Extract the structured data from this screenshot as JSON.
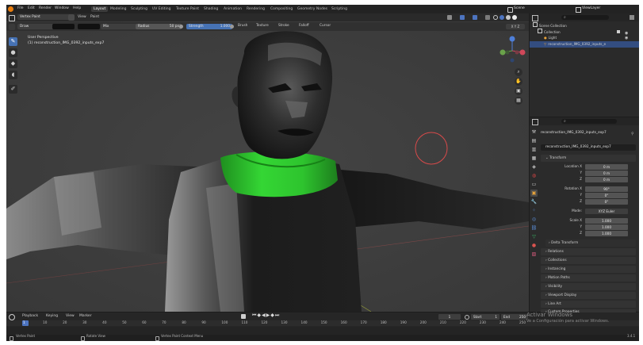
{
  "topbar": {
    "menus": [
      "File",
      "Edit",
      "Render",
      "Window",
      "Help"
    ],
    "workspaces": [
      "Layout",
      "Modeling",
      "Sculpting",
      "UV Editing",
      "Texture Paint",
      "Shading",
      "Animation",
      "Rendering",
      "Compositing",
      "Geometry Nodes",
      "Scripting"
    ],
    "active_workspace": "Layout",
    "scene": "Scene",
    "view_layer": "ViewLayer"
  },
  "viewport_header": {
    "mode": "Vertex Paint",
    "view_label": "View",
    "paint_label": "Paint"
  },
  "tool_settings": {
    "brush_name": "Draw",
    "blend": "Mix",
    "radius_label": "Radius",
    "radius_value": "50 px",
    "strength_label": "Strength",
    "strength_value": "1.000",
    "menus": [
      "Brush",
      "Texture",
      "Stroke",
      "Falloff",
      "Cursor"
    ]
  },
  "viewport": {
    "perspective": "User Perspective",
    "object_line": "(1) reconstruction_IMG_0392_inputs_exp7",
    "axes": [
      "X",
      "Y",
      "Z"
    ],
    "brush_color": "#2ecc2e"
  },
  "outliner": {
    "search_placeholder": "",
    "items": [
      {
        "label": "Scene Collection"
      },
      {
        "label": "Collection"
      },
      {
        "label": "Light"
      },
      {
        "label": "reconstruction_IMG_0392_inputs_e"
      }
    ]
  },
  "properties": {
    "object_name": "reconstruction_IMG_0392_inputs_exp7",
    "object_field": "reconstruction_IMG_0392_inputs_exp7",
    "transform_label": "Transform",
    "location": {
      "label": "Location X",
      "x": "0 m",
      "y": "0 m",
      "z": "0 m"
    },
    "rotation": {
      "label": "Rotation X",
      "x": "90°",
      "y": "0°",
      "z": "0°"
    },
    "mode_label": "Mode:",
    "mode_value": "XYZ Euler",
    "scale": {
      "label": "Scale X",
      "x": "1.000",
      "y": "1.000",
      "z": "1.000"
    },
    "axis_y": "Y",
    "axis_z": "Z",
    "panels": [
      "Delta Transform",
      "Relations",
      "Collections",
      "Instancing",
      "Motion Paths",
      "Visibility",
      "Viewport Display",
      "Line Art",
      "Custom Properties"
    ]
  },
  "timeline": {
    "menus": [
      "Playback",
      "Keying",
      "View",
      "Marker"
    ],
    "current_frame": "1",
    "start_label": "Start",
    "start_value": "1",
    "end_label": "End",
    "end_value": "250",
    "ticks": [
      "1",
      "10",
      "20",
      "30",
      "40",
      "50",
      "60",
      "70",
      "80",
      "90",
      "100",
      "110",
      "120",
      "130",
      "140",
      "150",
      "160",
      "170",
      "180",
      "190",
      "200",
      "210",
      "220",
      "230",
      "240",
      "250"
    ]
  },
  "watermark": {
    "line1": "Activar Windows",
    "line2": "Ve a Configuración para activar Windows."
  },
  "statusbar": {
    "left": "Vertex Paint",
    "middle": "Rotate View",
    "right": "Vertex Paint Context Menu",
    "version": "3.4.1"
  }
}
